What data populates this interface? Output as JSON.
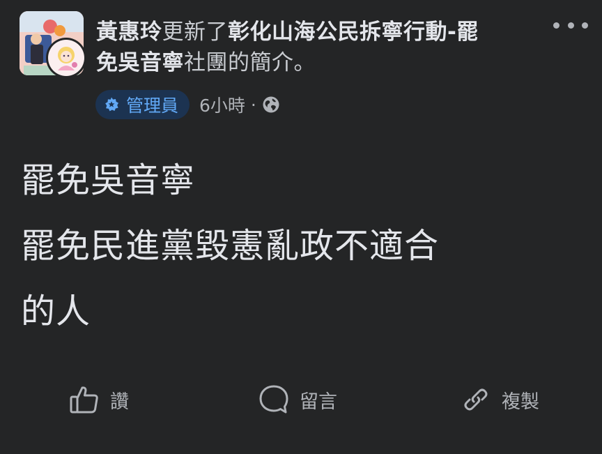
{
  "post": {
    "author": "黃惠玲",
    "action_text": "更新了",
    "group_name": "彰化山海公民拆寧行動-罷免吳音寧",
    "suffix_text": "社團的簡介。",
    "role_badge": "管理員",
    "timestamp": "6小時",
    "separator": "·",
    "privacy_icon": "globe-icon",
    "body_lines": [
      "罷免吳音寧",
      "罷免民進黨毀憲亂政不適合",
      "的人"
    ]
  },
  "actions": {
    "like_label": "讚",
    "comment_label": "留言",
    "copy_label": "複製"
  },
  "colors": {
    "background": "#242526",
    "primary_text": "#e4e6eb",
    "secondary_text": "#b0b3b8",
    "badge_background": "#1c3351",
    "badge_text": "#61a8f5"
  }
}
